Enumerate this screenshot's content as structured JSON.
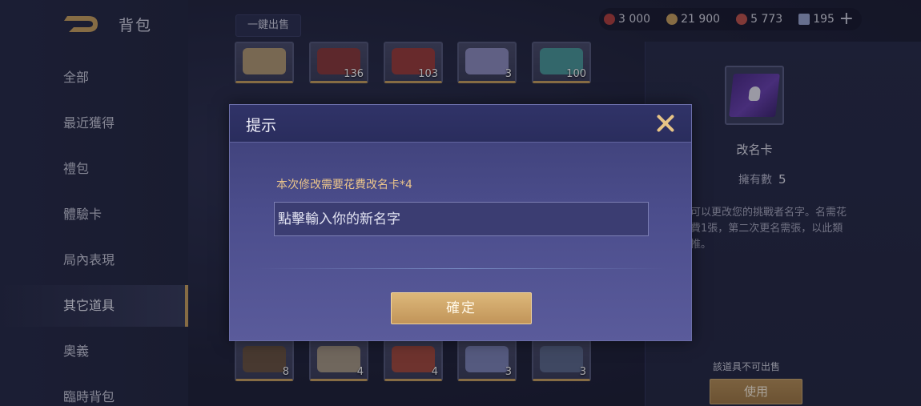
{
  "header": {
    "title": "背包",
    "sell_all_label": "一鍵出售",
    "currencies": [
      {
        "icon": "gem-icon",
        "value": "3 000",
        "color": "#b3403c"
      },
      {
        "icon": "coin-icon",
        "value": "21 900",
        "color": "#c9a25e"
      },
      {
        "icon": "ruby-icon",
        "value": "5 773",
        "color": "#c0544a"
      },
      {
        "icon": "ticket-icon",
        "value": "195",
        "color": "#9aa6d0"
      }
    ],
    "add_label": "+"
  },
  "sidebar": {
    "items": [
      {
        "label": "全部"
      },
      {
        "label": "最近獲得"
      },
      {
        "label": "禮包"
      },
      {
        "label": "體驗卡"
      },
      {
        "label": "局內表現"
      },
      {
        "label": "其它道具",
        "active": true
      },
      {
        "label": "奧義"
      },
      {
        "label": "臨時背包"
      }
    ]
  },
  "grid": {
    "row1": [
      {
        "count": ""
      },
      {
        "count": "136"
      },
      {
        "count": "103"
      },
      {
        "count": "3"
      },
      {
        "count": "100"
      }
    ],
    "row3": [
      {
        "count": "8"
      },
      {
        "count": "4"
      },
      {
        "count": "4"
      },
      {
        "count": "3"
      },
      {
        "count": "3"
      }
    ]
  },
  "detail": {
    "name": "改名卡",
    "own_label": "擁有數",
    "own_count": "5",
    "description": "可以更改您的挑戰者名字。名需花費1張，第二次更名需張，以此類推。",
    "not_sellable": "該道具不可出售",
    "use_label": "使用"
  },
  "dialog": {
    "title": "提示",
    "notice": "本次修改需要花費改名卡*4",
    "input_placeholder": "點擊輸入你的新名字",
    "confirm_label": "確定"
  }
}
